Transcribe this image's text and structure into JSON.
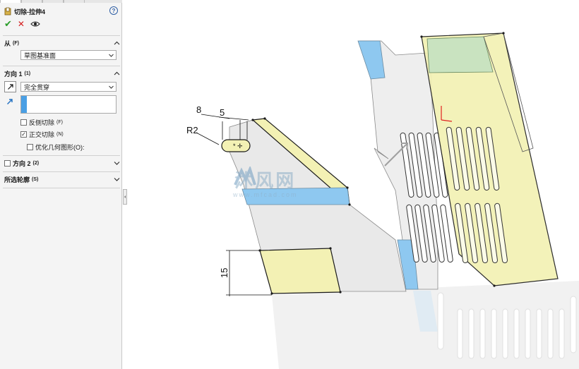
{
  "panel": {
    "feature_title": "切除-拉伸4",
    "help_icon": "?",
    "from_section": {
      "label": "从",
      "shortcut": "(F)",
      "value": "草图基准面"
    },
    "direction1_section": {
      "label": "方向 1",
      "shortcut": "(1)",
      "end_condition": "完全贯穿",
      "options": [
        {
          "label": "反侧切除",
          "shortcut": "(F)",
          "checked": false
        },
        {
          "label": "正交切除",
          "shortcut": "(N)",
          "checked": true
        },
        {
          "label": "优化几何图形(O):",
          "shortcut": "",
          "checked": false
        }
      ]
    },
    "direction2_section": {
      "label": "方向 2",
      "shortcut": "(2)",
      "checked": false
    },
    "selected_contours_section": {
      "label": "所选轮廓",
      "shortcut": "(S)"
    }
  },
  "viewport": {
    "dimensions": {
      "d1": "8",
      "d2": "5",
      "d3": "R2",
      "d4": "15"
    },
    "watermark": {
      "text": "沐风网",
      "url": "www.mfcad.com"
    }
  },
  "colors": {
    "accent_blue": "#4a9fe4",
    "face_yellow": "#f3f1b4",
    "face_blue": "#8ec8f0",
    "face_green": "#c9e3c0",
    "ok_green": "#2a9d2a",
    "cancel_red": "#d42020"
  },
  "icons": {
    "feature": "cut-extrude-icon",
    "help": "help-icon",
    "ok": "checkmark-icon",
    "cancel": "close-icon",
    "preview": "eye-icon",
    "direction": "reverse-direction-icon",
    "chevron": "chevron-icon"
  }
}
